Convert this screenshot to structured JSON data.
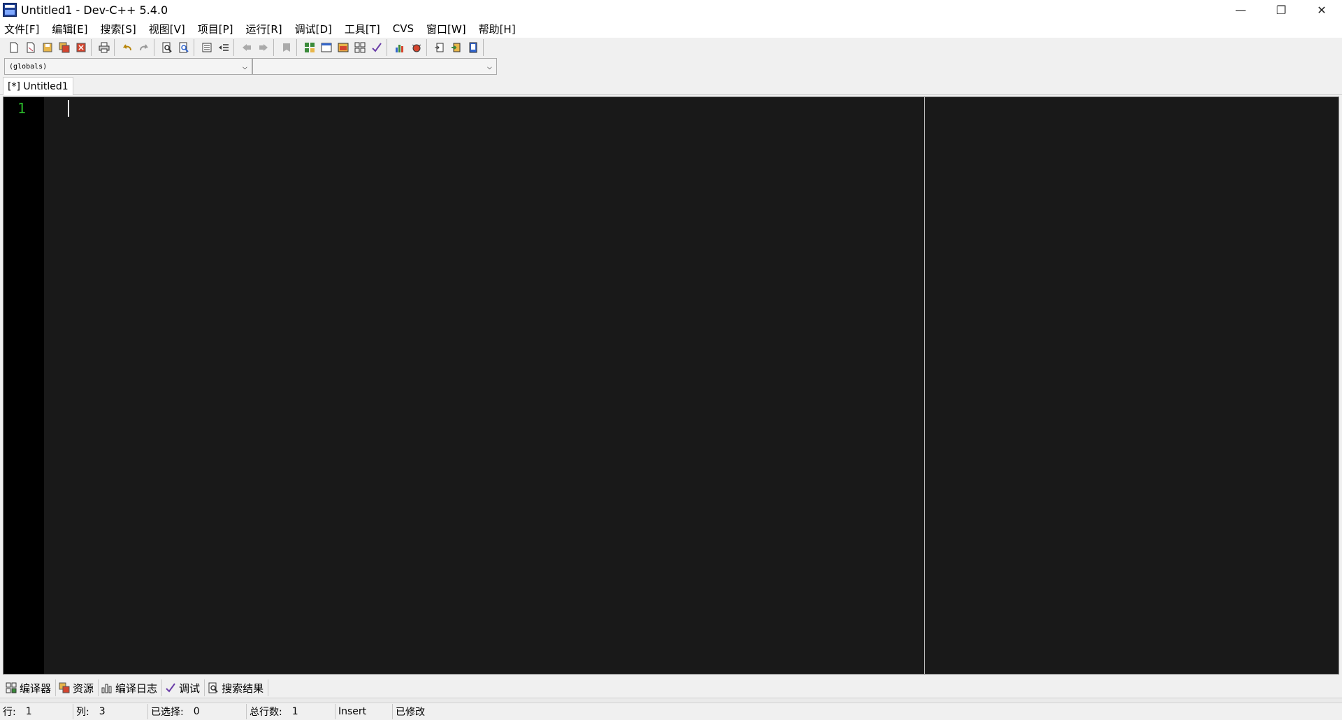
{
  "window": {
    "title": "Untitled1 - Dev-C++ 5.4.0",
    "controls": {
      "minimize": "—",
      "restore": "❐",
      "close": "✕"
    }
  },
  "menu": [
    "文件[F]",
    "编辑[E]",
    "搜索[S]",
    "视图[V]",
    "项目[P]",
    "运行[R]",
    "调试[D]",
    "工具[T]",
    "CVS",
    "窗口[W]",
    "帮助[H]"
  ],
  "selectors": {
    "scope": "(globals)",
    "member": ""
  },
  "tabs": [
    {
      "label": "[*] Untitled1",
      "active": true
    }
  ],
  "editor": {
    "line_numbers": [
      "1"
    ],
    "background": "#191919",
    "gutter_background": "#000000",
    "line_number_color": "#2ab82a"
  },
  "bottom_tabs": [
    {
      "label": "编译器",
      "icon": "compiler-icon"
    },
    {
      "label": "资源",
      "icon": "resources-icon"
    },
    {
      "label": "编译日志",
      "icon": "chart-icon"
    },
    {
      "label": "调试",
      "icon": "check-icon"
    },
    {
      "label": "搜索结果",
      "icon": "search-icon"
    }
  ],
  "status": {
    "row_label": "行:",
    "row_value": "1",
    "col_label": "列:",
    "col_value": "3",
    "sel_label": "已选择:",
    "sel_value": "0",
    "total_label": "总行数:",
    "total_value": "1",
    "mode": "Insert",
    "modified": "已修改"
  }
}
